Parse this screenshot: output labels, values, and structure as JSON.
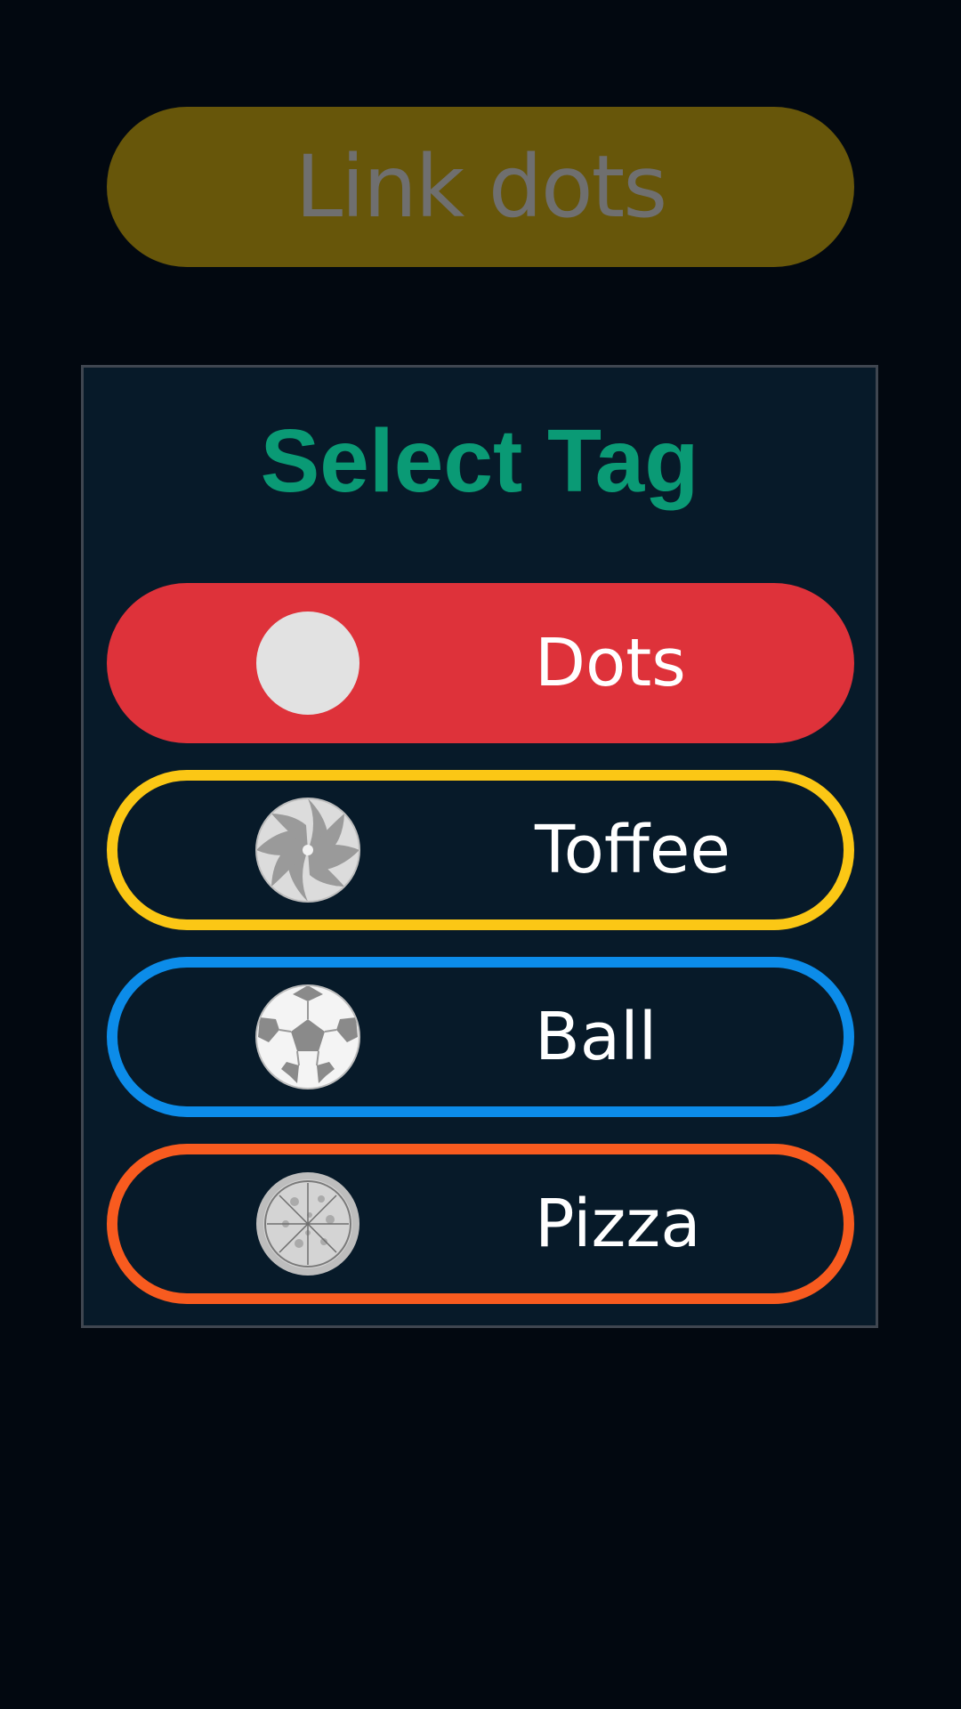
{
  "top_button": {
    "label": "Link dots",
    "color": "#67560a"
  },
  "dialog": {
    "title": "Select Tag",
    "options": [
      {
        "label": "Dots",
        "icon": "dots-icon",
        "color": "#de323a",
        "selected": true
      },
      {
        "label": "Toffee",
        "icon": "toffee-icon",
        "color": "#fbc715",
        "selected": false
      },
      {
        "label": "Ball",
        "icon": "ball-icon",
        "color": "#0c8ce9",
        "selected": false
      },
      {
        "label": "Pizza",
        "icon": "pizza-icon",
        "color": "#f85b1f",
        "selected": false
      }
    ]
  }
}
